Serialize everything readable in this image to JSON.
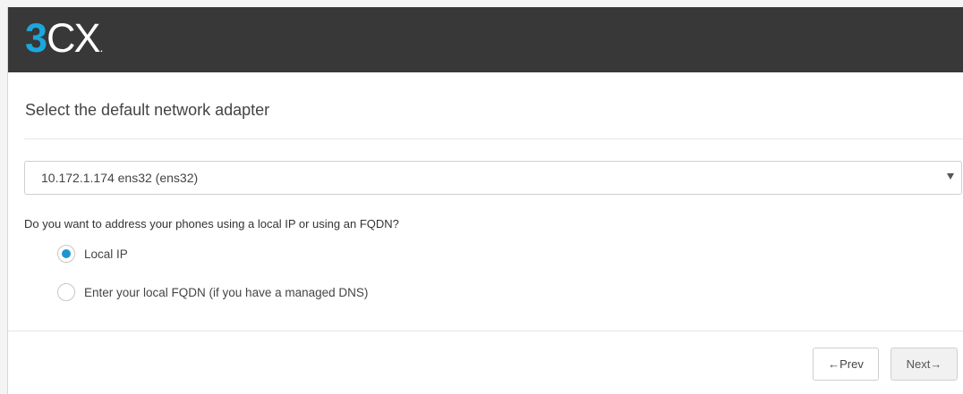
{
  "brand": {
    "logo_accent": "3",
    "logo_text": "CX",
    "logo_dot": ".",
    "accent_color": "#1ba7dd",
    "header_color": "#383838"
  },
  "page": {
    "title": "Select the default network adapter"
  },
  "adapter_select": {
    "selected_value": "10.172.1.174 ens32 (ens32)",
    "arrow_icon": "dropdown-arrow-icon"
  },
  "question": {
    "text": "Do you want to address your phones using a local IP or using an FQDN?"
  },
  "options": [
    {
      "label": "Local IP",
      "checked": true
    },
    {
      "label": "Enter your local FQDN (if you have a managed DNS)",
      "checked": false
    }
  ],
  "navigation": {
    "prev_label": "←Prev",
    "next_label": "Next→"
  }
}
